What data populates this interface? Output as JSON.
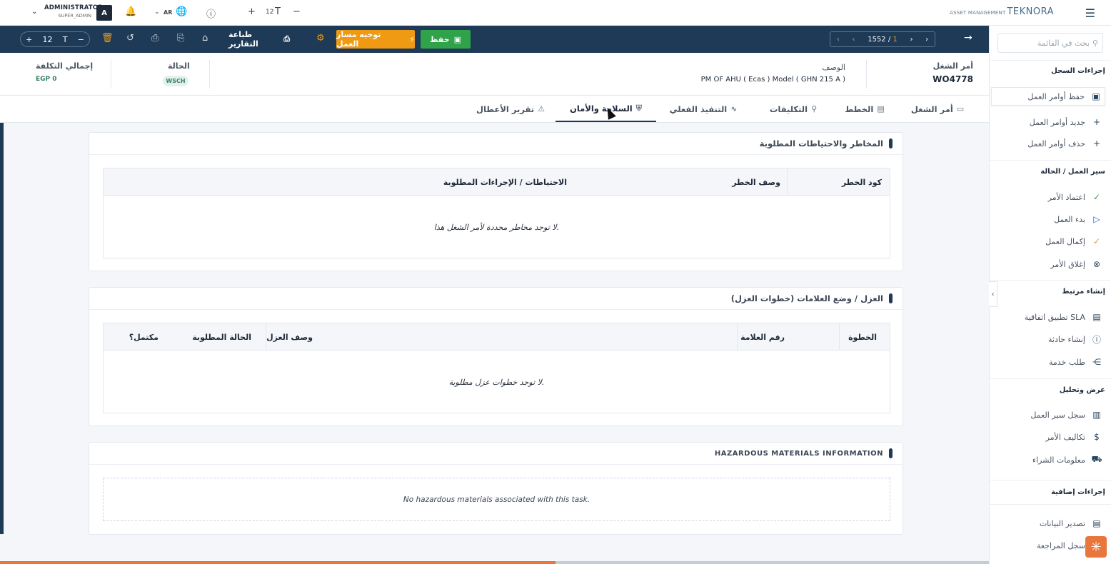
{
  "header": {
    "user_name": "ADMINISTRATOR",
    "user_role": "SUPER_ADMIN",
    "avatar_letter": "A",
    "language": "AR",
    "font_size": "12",
    "brand_sub": "ASSET MANAGEMENT",
    "brand_main": "TEKNORA"
  },
  "toolbar": {
    "save_label": "حفظ",
    "route_label": "توجيه مسار العمل",
    "print_label": "طباعة التقارير",
    "font_size": "12",
    "pager_total": "1552",
    "pager_current": "1"
  },
  "info": {
    "wo_label": "أمر الشغل",
    "wo_value": "WO4778",
    "desc_label": "الوصف",
    "desc_value": "PM OF AHU  ( Ecas ) Model ( GHN 215 A )",
    "status_label": "الحالة",
    "status_value": "WSCH",
    "cost_label": "إجمالي التكلفة",
    "cost_value": "EGP 0"
  },
  "tabs": [
    "أمر الشغل",
    "الخطط",
    "التكليفات",
    "التنفيذ الفعلي",
    "السلامة والأمان",
    "تقرير الأعطال"
  ],
  "panels": {
    "hazards": {
      "title": "المخاطر والاحتياطات المطلوبة",
      "col_code": "كود الخطر",
      "col_desc": "وصف الخطر",
      "col_precautions": "الاحتياطات / الإجراءات المطلوبة",
      "empty": "لا توجد مخاطر محددة لأمر الشغل هذا."
    },
    "isolation": {
      "title": "العزل / وضع العلامات (خطوات العزل)",
      "col_step": "الخطوة",
      "col_tag": "رقم العلامة",
      "col_desc": "وصف العزل",
      "col_state": "الحالة المطلوبة",
      "col_done": "مكتمل؟",
      "empty": "لا توجد خطوات عزل مطلوبة."
    },
    "hazmat": {
      "title": "HAZARDOUS MATERIALS INFORMATION",
      "empty": "No hazardous materials associated with this task."
    }
  },
  "sidebar": {
    "search_placeholder": "بحث في القائمة",
    "sections": {
      "record": "إجراءات السجل",
      "workflow": "سير العمل / الحالة",
      "create": "إنشاء مرتبط",
      "view": "عرض وتحليل",
      "extra": "إجراءات إضافية"
    },
    "items": {
      "save_wo": "حفظ أوامر العمل",
      "new_wo": "جديد أوامر العمل",
      "delete_wo": "حذف أوامر العمل",
      "approve": "اعتماد الأمر",
      "start": "بدء العمل",
      "complete": "إكمال العمل",
      "close": "إغلاق الأمر",
      "sla": "تطبيق اتفاقية SLA",
      "incident": "إنشاء حادثة",
      "service": "طلب خدمة",
      "wf_log": "سجل سير العمل",
      "costs": "تكاليف الأمر",
      "purchase": "معلومات الشراء",
      "export": "تصدير البيانات",
      "audit": "سجل المراجعة"
    }
  }
}
